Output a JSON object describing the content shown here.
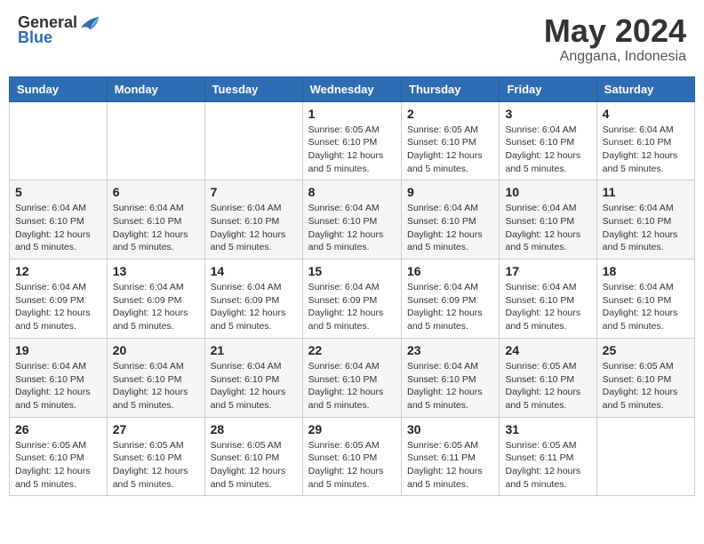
{
  "header": {
    "logo_general": "General",
    "logo_blue": "Blue",
    "month_title": "May 2024",
    "location": "Anggana, Indonesia"
  },
  "weekdays": [
    "Sunday",
    "Monday",
    "Tuesday",
    "Wednesday",
    "Thursday",
    "Friday",
    "Saturday"
  ],
  "weeks": [
    [
      {
        "day": "",
        "info": ""
      },
      {
        "day": "",
        "info": ""
      },
      {
        "day": "",
        "info": ""
      },
      {
        "day": "1",
        "info": "Sunrise: 6:05 AM\nSunset: 6:10 PM\nDaylight: 12 hours\nand 5 minutes."
      },
      {
        "day": "2",
        "info": "Sunrise: 6:05 AM\nSunset: 6:10 PM\nDaylight: 12 hours\nand 5 minutes."
      },
      {
        "day": "3",
        "info": "Sunrise: 6:04 AM\nSunset: 6:10 PM\nDaylight: 12 hours\nand 5 minutes."
      },
      {
        "day": "4",
        "info": "Sunrise: 6:04 AM\nSunset: 6:10 PM\nDaylight: 12 hours\nand 5 minutes."
      }
    ],
    [
      {
        "day": "5",
        "info": "Sunrise: 6:04 AM\nSunset: 6:10 PM\nDaylight: 12 hours\nand 5 minutes."
      },
      {
        "day": "6",
        "info": "Sunrise: 6:04 AM\nSunset: 6:10 PM\nDaylight: 12 hours\nand 5 minutes."
      },
      {
        "day": "7",
        "info": "Sunrise: 6:04 AM\nSunset: 6:10 PM\nDaylight: 12 hours\nand 5 minutes."
      },
      {
        "day": "8",
        "info": "Sunrise: 6:04 AM\nSunset: 6:10 PM\nDaylight: 12 hours\nand 5 minutes."
      },
      {
        "day": "9",
        "info": "Sunrise: 6:04 AM\nSunset: 6:10 PM\nDaylight: 12 hours\nand 5 minutes."
      },
      {
        "day": "10",
        "info": "Sunrise: 6:04 AM\nSunset: 6:10 PM\nDaylight: 12 hours\nand 5 minutes."
      },
      {
        "day": "11",
        "info": "Sunrise: 6:04 AM\nSunset: 6:10 PM\nDaylight: 12 hours\nand 5 minutes."
      }
    ],
    [
      {
        "day": "12",
        "info": "Sunrise: 6:04 AM\nSunset: 6:09 PM\nDaylight: 12 hours\nand 5 minutes."
      },
      {
        "day": "13",
        "info": "Sunrise: 6:04 AM\nSunset: 6:09 PM\nDaylight: 12 hours\nand 5 minutes."
      },
      {
        "day": "14",
        "info": "Sunrise: 6:04 AM\nSunset: 6:09 PM\nDaylight: 12 hours\nand 5 minutes."
      },
      {
        "day": "15",
        "info": "Sunrise: 6:04 AM\nSunset: 6:09 PM\nDaylight: 12 hours\nand 5 minutes."
      },
      {
        "day": "16",
        "info": "Sunrise: 6:04 AM\nSunset: 6:09 PM\nDaylight: 12 hours\nand 5 minutes."
      },
      {
        "day": "17",
        "info": "Sunrise: 6:04 AM\nSunset: 6:10 PM\nDaylight: 12 hours\nand 5 minutes."
      },
      {
        "day": "18",
        "info": "Sunrise: 6:04 AM\nSunset: 6:10 PM\nDaylight: 12 hours\nand 5 minutes."
      }
    ],
    [
      {
        "day": "19",
        "info": "Sunrise: 6:04 AM\nSunset: 6:10 PM\nDaylight: 12 hours\nand 5 minutes."
      },
      {
        "day": "20",
        "info": "Sunrise: 6:04 AM\nSunset: 6:10 PM\nDaylight: 12 hours\nand 5 minutes."
      },
      {
        "day": "21",
        "info": "Sunrise: 6:04 AM\nSunset: 6:10 PM\nDaylight: 12 hours\nand 5 minutes."
      },
      {
        "day": "22",
        "info": "Sunrise: 6:04 AM\nSunset: 6:10 PM\nDaylight: 12 hours\nand 5 minutes."
      },
      {
        "day": "23",
        "info": "Sunrise: 6:04 AM\nSunset: 6:10 PM\nDaylight: 12 hours\nand 5 minutes."
      },
      {
        "day": "24",
        "info": "Sunrise: 6:05 AM\nSunset: 6:10 PM\nDaylight: 12 hours\nand 5 minutes."
      },
      {
        "day": "25",
        "info": "Sunrise: 6:05 AM\nSunset: 6:10 PM\nDaylight: 12 hours\nand 5 minutes."
      }
    ],
    [
      {
        "day": "26",
        "info": "Sunrise: 6:05 AM\nSunset: 6:10 PM\nDaylight: 12 hours\nand 5 minutes."
      },
      {
        "day": "27",
        "info": "Sunrise: 6:05 AM\nSunset: 6:10 PM\nDaylight: 12 hours\nand 5 minutes."
      },
      {
        "day": "28",
        "info": "Sunrise: 6:05 AM\nSunset: 6:10 PM\nDaylight: 12 hours\nand 5 minutes."
      },
      {
        "day": "29",
        "info": "Sunrise: 6:05 AM\nSunset: 6:10 PM\nDaylight: 12 hours\nand 5 minutes."
      },
      {
        "day": "30",
        "info": "Sunrise: 6:05 AM\nSunset: 6:11 PM\nDaylight: 12 hours\nand 5 minutes."
      },
      {
        "day": "31",
        "info": "Sunrise: 6:05 AM\nSunset: 6:11 PM\nDaylight: 12 hours\nand 5 minutes."
      },
      {
        "day": "",
        "info": ""
      }
    ]
  ]
}
